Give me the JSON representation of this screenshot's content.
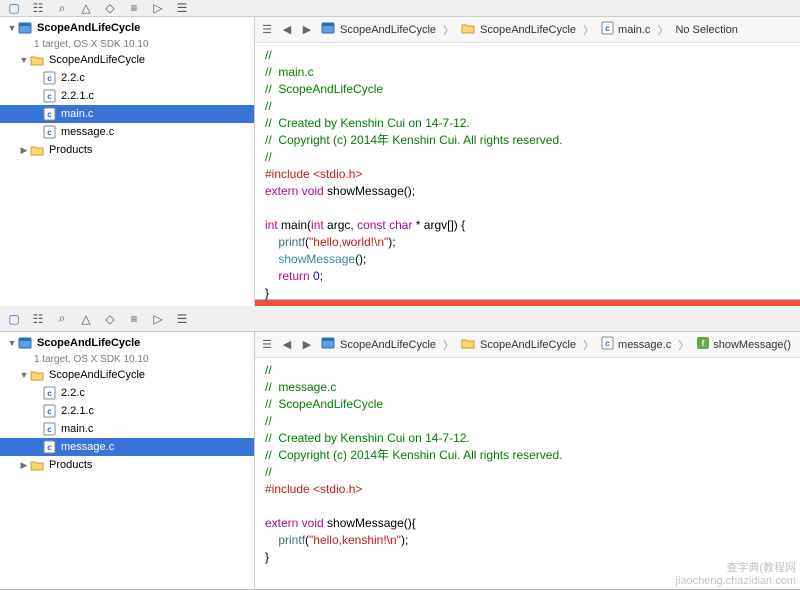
{
  "panes": [
    {
      "project": {
        "name": "ScopeAndLifeCycle",
        "subtitle": "1 target, OS X SDK 10.10",
        "groups": [
          {
            "name": "ScopeAndLifeCycle",
            "open": true,
            "files": [
              {
                "name": "2.2.c",
                "selected": false
              },
              {
                "name": "2.2.1.c",
                "selected": false
              },
              {
                "name": "main.c",
                "selected": true
              },
              {
                "name": "message.c",
                "selected": false
              }
            ]
          },
          {
            "name": "Products",
            "open": false,
            "files": []
          }
        ]
      },
      "breadcrumb": [
        {
          "icon": "proj",
          "label": "ScopeAndLifeCycle"
        },
        {
          "icon": "folder",
          "label": "ScopeAndLifeCycle"
        },
        {
          "icon": "cfile",
          "label": "main.c"
        },
        {
          "icon": "none",
          "label": "No Selection"
        }
      ],
      "code": {
        "lines": [
          {
            "t": "//",
            "cls": "c-green"
          },
          {
            "t": "//  main.c",
            "cls": "c-green"
          },
          {
            "t": "//  ScopeAndLifeCycle",
            "cls": "c-green"
          },
          {
            "t": "//",
            "cls": "c-green"
          },
          {
            "t": "//  Created by Kenshin Cui on 14-7-12.",
            "cls": "c-green"
          },
          {
            "t": "//  Copyright (c) 2014年 Kenshin Cui. All rights reserved.",
            "cls": "c-green"
          },
          {
            "t": "//",
            "cls": "c-green"
          },
          {
            "t": "",
            "cls": ""
          }
        ],
        "include": {
          "pre": "#include ",
          "hdr": "<stdio.h>"
        },
        "extern_line": {
          "kw": "extern void",
          "name": " showMessage();"
        },
        "main_sig": {
          "kw": "int",
          "name": " main(",
          "kw2": "int",
          "p1": " argc, ",
          "kw3": "const char",
          "p2": " * argv[]) {"
        },
        "printf": {
          "fn": "printf",
          "arg": "\"hello,world!\\n\""
        },
        "call": "showMessage();",
        "ret": {
          "kw": "return",
          "val": " 0",
          "end": ";"
        }
      }
    },
    {
      "project": {
        "name": "ScopeAndLifeCycle",
        "subtitle": "1 target, OS X SDK 10.10",
        "groups": [
          {
            "name": "ScopeAndLifeCycle",
            "open": true,
            "files": [
              {
                "name": "2.2.c",
                "selected": false
              },
              {
                "name": "2.2.1.c",
                "selected": false
              },
              {
                "name": "main.c",
                "selected": false
              },
              {
                "name": "message.c",
                "selected": true
              }
            ]
          },
          {
            "name": "Products",
            "open": false,
            "files": []
          }
        ]
      },
      "breadcrumb": [
        {
          "icon": "proj",
          "label": "ScopeAndLifeCycle"
        },
        {
          "icon": "folder",
          "label": "ScopeAndLifeCycle"
        },
        {
          "icon": "cfile",
          "label": "message.c"
        },
        {
          "icon": "func",
          "label": "showMessage()"
        }
      ],
      "code": {
        "lines": [
          {
            "t": "//",
            "cls": "c-green"
          },
          {
            "t": "//  message.c",
            "cls": "c-green"
          },
          {
            "t": "//  ScopeAndLifeCycle",
            "cls": "c-green"
          },
          {
            "t": "//",
            "cls": "c-green"
          },
          {
            "t": "//  Created by Kenshin Cui on 14-7-12.",
            "cls": "c-green"
          },
          {
            "t": "//  Copyright (c) 2014年 Kenshin Cui. All rights reserved.",
            "cls": "c-green"
          },
          {
            "t": "//",
            "cls": "c-green"
          },
          {
            "t": "",
            "cls": ""
          }
        ],
        "include": {
          "pre": "#include ",
          "hdr": "<stdio.h>"
        },
        "func_sig": {
          "kw": "extern void",
          "name": " showMessage(){"
        },
        "printf": {
          "fn": "printf",
          "arg": "\"hello,kenshin!\\n\""
        }
      }
    }
  ],
  "watermark": {
    "l1": "查字典(教程网",
    "l2": "jiaocheng.chazidian.com"
  }
}
